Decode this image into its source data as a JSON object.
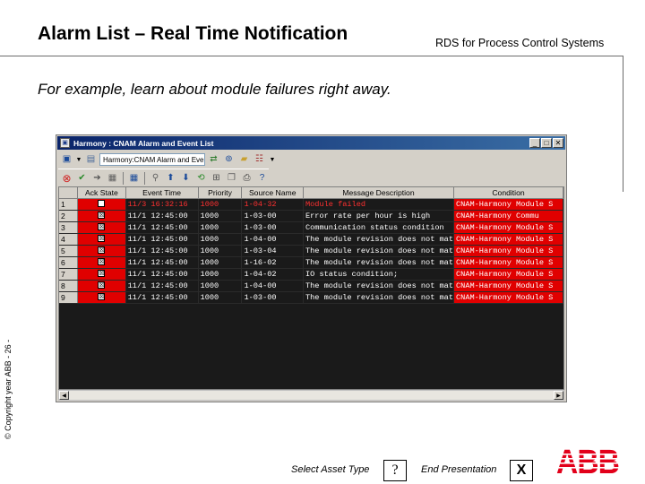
{
  "slide": {
    "title": "Alarm List – Real Time Notification",
    "subtitle": "RDS for Process Control Systems",
    "body": "For example, learn about module failures right away.",
    "copyright": "© Copyright year ABB - 26 -"
  },
  "window": {
    "title": "Harmony : CNAM Alarm and Event List",
    "controls": [
      "_",
      "□",
      "✕"
    ],
    "location_combo": "Harmony:CNAM Alarm and Event Lis",
    "icons_row1": [
      "window-icon",
      "dropdown-icon",
      "list-icon",
      "navigate-icon",
      "explore-icon",
      "folder-icon",
      "properties-icon",
      "menu-icon"
    ],
    "icons_row2": [
      "stop-icon",
      "acknowledge-icon",
      "arrow-icon",
      "group-icon",
      "calendar-icon",
      "search-icon",
      "up-icon",
      "down-icon",
      "refresh-icon",
      "filter-icon",
      "copy-icon",
      "print-icon",
      "help-icon"
    ]
  },
  "alarm_table": {
    "columns": [
      "",
      "Ack State",
      "Event Time",
      "Priority",
      "Source Name",
      "Message Description",
      "Condition"
    ],
    "rows": [
      {
        "num": "1",
        "ack": "",
        "time": "11/3 16:32:16",
        "priority": "1000",
        "source": "1-04-32",
        "message": "Module failed",
        "condition": "CNAM-Harmony Module S",
        "active": true
      },
      {
        "num": "2",
        "ack": "☒",
        "time": "11/1 12:45:00",
        "priority": "1000",
        "source": "1-03-00",
        "message": "Error rate per hour is high",
        "condition": "CNAM-Harmony Commu",
        "active": false
      },
      {
        "num": "3",
        "ack": "☒",
        "time": "11/1 12:45:00",
        "priority": "1000",
        "source": "1-03-00",
        "message": "Communication status condition",
        "condition": "CNAM-Harmony Module S",
        "active": false
      },
      {
        "num": "4",
        "ack": "☒",
        "time": "11/1 12:45:00",
        "priority": "1000",
        "source": "1-04-00",
        "message": "The module revision does not mat",
        "condition": "CNAM-Harmony Module S",
        "active": false
      },
      {
        "num": "5",
        "ack": "☒",
        "time": "11/1 12:45:00",
        "priority": "1000",
        "source": "1-03-04",
        "message": "The module revision does not mat",
        "condition": "CNAM-Harmony Module S",
        "active": false
      },
      {
        "num": "6",
        "ack": "☒",
        "time": "11/1 12:45:00",
        "priority": "1000",
        "source": "1-16-02",
        "message": "The module revision does not mat",
        "condition": "CNAM-Harmony Module S",
        "active": false
      },
      {
        "num": "7",
        "ack": "☒",
        "time": "11/1 12:45:00",
        "priority": "1000",
        "source": "1-04-02",
        "message": "IO status condition;",
        "condition": "CNAM-Harmony Module S",
        "active": false
      },
      {
        "num": "8",
        "ack": "☒",
        "time": "11/1 12:45:00",
        "priority": "1000",
        "source": "1-04-00",
        "message": "The module revision does not mat",
        "condition": "CNAM-Harmony Module S",
        "active": false
      },
      {
        "num": "9",
        "ack": "☒",
        "time": "11/1 12:45:00",
        "priority": "1000",
        "source": "1-03-00",
        "message": "The module revision does not mat",
        "condition": "CNAM-Harmony Module S",
        "active": false
      }
    ]
  },
  "nav": {
    "asset_label": "Select Asset Type",
    "asset_btn": "?",
    "end_label": "End Presentation",
    "end_btn": "X"
  },
  "logo": {
    "text": "ABB",
    "color": "#e2001a"
  },
  "colors": {
    "alarm_red": "#e00000",
    "title_blue": "#0a246a",
    "grid_bg": "#1a1a1a"
  }
}
